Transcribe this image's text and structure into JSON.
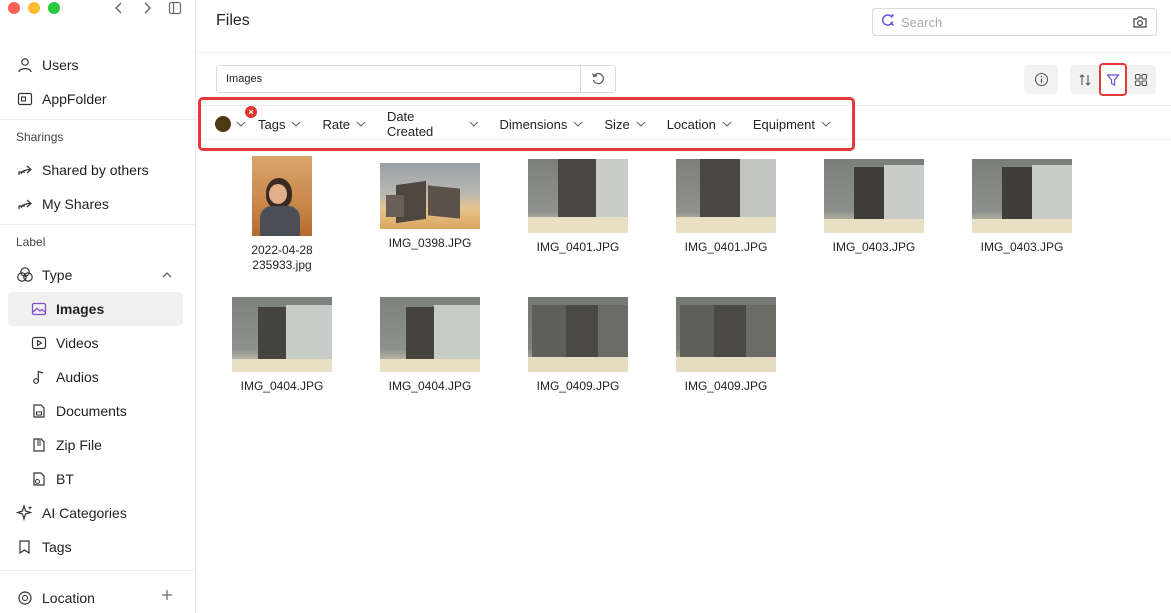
{
  "window": {
    "traffic_lights": [
      "close",
      "minimize",
      "maximize"
    ]
  },
  "sidebar": {
    "items_top": [
      {
        "label": "Users",
        "icon": "user-icon"
      },
      {
        "label": "AppFolder",
        "icon": "app-folder-icon"
      }
    ],
    "sharings_heading": "Sharings",
    "sharings": [
      {
        "label": "Shared by others",
        "icon": "share-icon"
      },
      {
        "label": "My Shares",
        "icon": "share-icon"
      }
    ],
    "label_heading": "Label",
    "type_label": "Type",
    "types": [
      {
        "label": "Images",
        "icon": "image-icon",
        "active": true
      },
      {
        "label": "Videos",
        "icon": "video-icon"
      },
      {
        "label": "Audios",
        "icon": "music-icon"
      },
      {
        "label": "Documents",
        "icon": "document-icon"
      },
      {
        "label": "Zip File",
        "icon": "zip-icon"
      },
      {
        "label": "BT",
        "icon": "bt-icon"
      }
    ],
    "ai_categories": "AI Categories",
    "tags": "Tags",
    "location": "Location"
  },
  "header": {
    "title": "Files",
    "search_placeholder": "Search"
  },
  "pathbar": {
    "path": "Images"
  },
  "filters": {
    "color_value": "#4d3a12",
    "labels": [
      "Tags",
      "Rate",
      "Date Created",
      "Dimensions",
      "Size",
      "Location",
      "Equipment"
    ]
  },
  "files": [
    {
      "name": "2022-04-28 235933.jpg",
      "line1": "2022-04-28",
      "line2": "235933.jpg",
      "kind": "portrait"
    },
    {
      "name": "IMG_0398.JPG",
      "kind": "boxes"
    },
    {
      "name": "IMG_0401.JPG",
      "kind": "gray"
    },
    {
      "name": "IMG_0401.JPG",
      "kind": "gray"
    },
    {
      "name": "IMG_0403.JPG",
      "kind": "gray"
    },
    {
      "name": "IMG_0403.JPG",
      "kind": "gray"
    },
    {
      "name": "IMG_0404.JPG",
      "kind": "gray"
    },
    {
      "name": "IMG_0404.JPG",
      "kind": "gray"
    },
    {
      "name": "IMG_0409.JPG",
      "kind": "gray2"
    },
    {
      "name": "IMG_0409.JPG",
      "kind": "gray2"
    }
  ]
}
